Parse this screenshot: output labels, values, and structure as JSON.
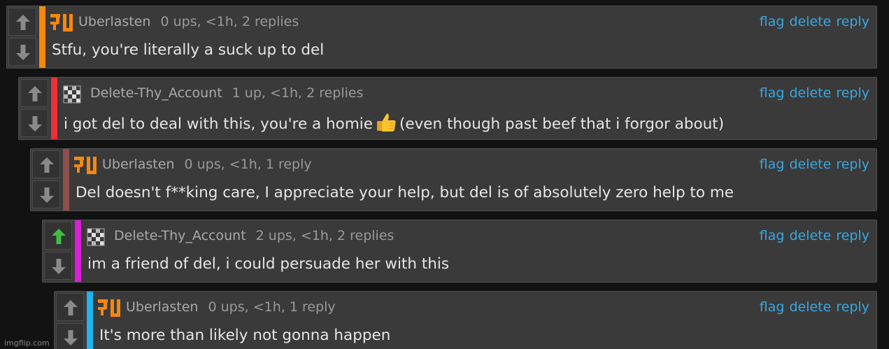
{
  "colors": {
    "background": "#121212",
    "card": "#3a3a3a",
    "link": "#38a8e2",
    "upvote_active": "#3fbf3f",
    "arrow_default": "#8a8a8a"
  },
  "comments": [
    {
      "username": "Uberlasten",
      "stats": "0 ups, <1h, 2 replies",
      "text": "Stfu, you're literally a suck up to del",
      "bar_color": "#f5870f",
      "avatar_icon": "uberlasten-logo-icon",
      "upvoted": false
    },
    {
      "username": "Delete-Thy_Account",
      "stats": "1 up, <1h, 2 replies",
      "text_before": "i got del to deal with this, you're a homie",
      "emoji": "thumbs-up-icon",
      "text_after": "(even though past beef that i forgor about)",
      "bar_color": "#ee3036",
      "avatar_icon": "checker-avatar-icon",
      "upvoted": false
    },
    {
      "username": "Uberlasten",
      "stats": "0 ups, <1h, 1 reply",
      "text": "Del doesn't f**king care, I appreciate your help, but del is of absolutely zero help to me",
      "bar_color": "#8e4f4a",
      "avatar_icon": "uberlasten-logo-icon",
      "upvoted": false
    },
    {
      "username": "Delete-Thy_Account",
      "stats": "2 ups, <1h, 2 replies",
      "text": "im a friend of del, i could persuade her with this",
      "bar_color": "#dc1ed8",
      "avatar_icon": "checker-avatar-icon",
      "upvoted": true
    },
    {
      "username": "Uberlasten",
      "stats": "0 ups, <1h, 1 reply",
      "text": "It's more than likely not gonna happen",
      "bar_color": "#1eb4ee",
      "avatar_icon": "uberlasten-logo-icon",
      "upvoted": false
    }
  ],
  "actions": {
    "flag": "flag",
    "delete": "delete",
    "reply": "reply"
  },
  "watermark": "imgflip.com"
}
